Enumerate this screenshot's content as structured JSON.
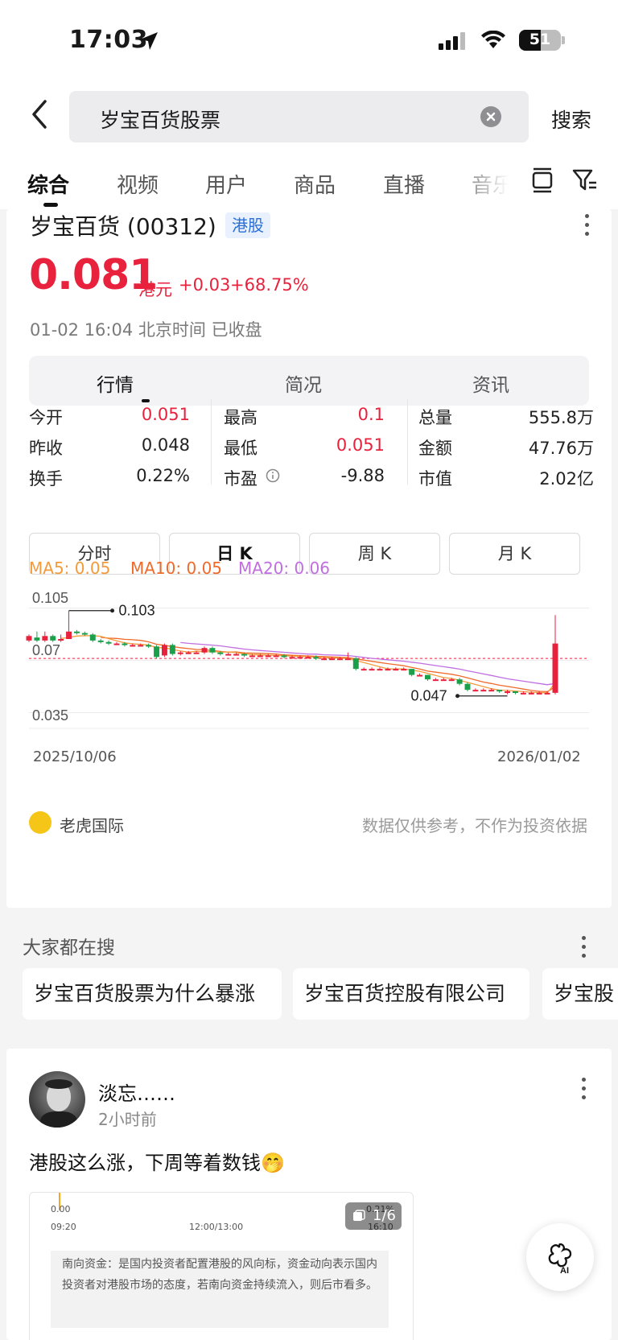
{
  "status_bar": {
    "time": "17:03",
    "battery": "51"
  },
  "search": {
    "query": "岁宝百货股票",
    "button": "搜索"
  },
  "tabs": [
    "综合",
    "视频",
    "用户",
    "商品",
    "直播",
    "音乐"
  ],
  "stock": {
    "name": "岁宝百货 (00312)",
    "market_badge": "港股",
    "price": "0.081",
    "currency": "港元",
    "change": "+0.03",
    "change_pct": "+68.75%",
    "timestamp": "01-02 16:04  北京时间 已收盘",
    "subtabs": [
      "行情",
      "简况",
      "资讯"
    ],
    "quote": [
      {
        "label": "今开",
        "value": "0.051",
        "red": true
      },
      {
        "label": "最高",
        "value": "0.1",
        "red": true
      },
      {
        "label": "总量",
        "value": "555.8万",
        "red": false
      },
      {
        "label": "昨收",
        "value": "0.048",
        "red": false
      },
      {
        "label": "最低",
        "value": "0.051",
        "red": true
      },
      {
        "label": "金额",
        "value": "47.76万",
        "red": false
      },
      {
        "label": "换手",
        "value": "0.22%",
        "red": false
      },
      {
        "label": "市盈",
        "value": "-9.88",
        "red": false
      },
      {
        "label": "市值",
        "value": "2.02亿",
        "red": false
      }
    ],
    "period_buttons": [
      "分时",
      "日 K",
      "周 K",
      "月 K"
    ],
    "ma": {
      "ma5": "MA5: 0.05",
      "ma10": "MA10: 0.05",
      "ma20": "MA20: 0.06"
    },
    "colors": {
      "up": "#e8213d",
      "down": "#1aa04a",
      "ma5": "#f39b3a",
      "ma10": "#f06a2a",
      "ma20": "#c06ee0"
    },
    "source": "老虎国际",
    "disclaimer": "数据仅供参考，不作为投资依据"
  },
  "chart_data": {
    "type": "candlestick",
    "yticks": [
      "0.105",
      "0.07",
      "0.035"
    ],
    "ylim": [
      0.035,
      0.105
    ],
    "x_start": "2025/10/06",
    "x_end": "2026/01/02",
    "high_marker": "0.103",
    "low_marker": "0.047",
    "prev_close_line": 0.071,
    "candles": [
      [
        0.083,
        0.086,
        0.087,
        0.082
      ],
      [
        0.085,
        0.083,
        0.089,
        0.082
      ],
      [
        0.083,
        0.086,
        0.089,
        0.082
      ],
      [
        0.086,
        0.083,
        0.087,
        0.082
      ],
      [
        0.083,
        0.084,
        0.087,
        0.082
      ],
      [
        0.084,
        0.089,
        0.103,
        0.084
      ],
      [
        0.089,
        0.088,
        0.09,
        0.087
      ],
      [
        0.088,
        0.087,
        0.089,
        0.086
      ],
      [
        0.087,
        0.083,
        0.088,
        0.082
      ],
      [
        0.083,
        0.082,
        0.084,
        0.081
      ],
      [
        0.082,
        0.081,
        0.083,
        0.08
      ],
      [
        0.081,
        0.081,
        0.082,
        0.08
      ],
      [
        0.081,
        0.08,
        0.082,
        0.079
      ],
      [
        0.08,
        0.08,
        0.081,
        0.079
      ],
      [
        0.08,
        0.08,
        0.081,
        0.079
      ],
      [
        0.08,
        0.079,
        0.081,
        0.078
      ],
      [
        0.079,
        0.072,
        0.08,
        0.071
      ],
      [
        0.073,
        0.08,
        0.081,
        0.072
      ],
      [
        0.08,
        0.074,
        0.081,
        0.073
      ],
      [
        0.074,
        0.075,
        0.076,
        0.073
      ],
      [
        0.075,
        0.075,
        0.076,
        0.074
      ],
      [
        0.075,
        0.075,
        0.076,
        0.074
      ],
      [
        0.075,
        0.078,
        0.079,
        0.074
      ],
      [
        0.078,
        0.075,
        0.079,
        0.074
      ],
      [
        0.075,
        0.074,
        0.076,
        0.073
      ],
      [
        0.074,
        0.074,
        0.075,
        0.073
      ],
      [
        0.074,
        0.074,
        0.075,
        0.073
      ],
      [
        0.074,
        0.073,
        0.075,
        0.072
      ],
      [
        0.073,
        0.073,
        0.074,
        0.072
      ],
      [
        0.073,
        0.073,
        0.074,
        0.072
      ],
      [
        0.073,
        0.073,
        0.074,
        0.072
      ],
      [
        0.073,
        0.073,
        0.074,
        0.072
      ],
      [
        0.073,
        0.072,
        0.074,
        0.071
      ],
      [
        0.072,
        0.072,
        0.073,
        0.071
      ],
      [
        0.072,
        0.072,
        0.073,
        0.071
      ],
      [
        0.072,
        0.072,
        0.073,
        0.071
      ],
      [
        0.072,
        0.071,
        0.073,
        0.07
      ],
      [
        0.071,
        0.071,
        0.072,
        0.07
      ],
      [
        0.071,
        0.071,
        0.072,
        0.07
      ],
      [
        0.071,
        0.071,
        0.072,
        0.07
      ],
      [
        0.071,
        0.071,
        0.075,
        0.07
      ],
      [
        0.071,
        0.064,
        0.072,
        0.063
      ],
      [
        0.064,
        0.064,
        0.065,
        0.063
      ],
      [
        0.064,
        0.064,
        0.065,
        0.063
      ],
      [
        0.064,
        0.064,
        0.065,
        0.063
      ],
      [
        0.064,
        0.064,
        0.065,
        0.063
      ],
      [
        0.064,
        0.064,
        0.065,
        0.063
      ],
      [
        0.064,
        0.064,
        0.065,
        0.063
      ],
      [
        0.064,
        0.06,
        0.064,
        0.059
      ],
      [
        0.06,
        0.06,
        0.061,
        0.059
      ],
      [
        0.06,
        0.057,
        0.06,
        0.056
      ],
      [
        0.057,
        0.057,
        0.058,
        0.056
      ],
      [
        0.057,
        0.057,
        0.058,
        0.056
      ],
      [
        0.057,
        0.057,
        0.058,
        0.056
      ],
      [
        0.057,
        0.054,
        0.058,
        0.053
      ],
      [
        0.054,
        0.05,
        0.055,
        0.049
      ],
      [
        0.05,
        0.05,
        0.051,
        0.049
      ],
      [
        0.05,
        0.05,
        0.051,
        0.049
      ],
      [
        0.05,
        0.05,
        0.051,
        0.049
      ],
      [
        0.05,
        0.049,
        0.05,
        0.048
      ],
      [
        0.049,
        0.049,
        0.05,
        0.047
      ],
      [
        0.049,
        0.048,
        0.049,
        0.047
      ],
      [
        0.048,
        0.048,
        0.049,
        0.047
      ],
      [
        0.048,
        0.048,
        0.049,
        0.047
      ],
      [
        0.048,
        0.048,
        0.049,
        0.047
      ],
      [
        0.048,
        0.048,
        0.049,
        0.047
      ],
      [
        0.048,
        0.081,
        0.1,
        0.047
      ]
    ]
  },
  "hot_searches": {
    "title": "大家都在搜",
    "items": [
      "岁宝百货股票为什么暴涨",
      "岁宝百货控股有限公司",
      "岁宝股"
    ]
  },
  "post": {
    "username": "淡忘……",
    "time": "2小时前",
    "text": "港股这么涨，下周等着数钱🤭",
    "image_labels": {
      "t0": "0.00",
      "t1": "09:20",
      "t2": "12:00/13:00",
      "t3": "0.21%",
      "t4": "16:10",
      "count": "1/6"
    },
    "image_note": "南向资金：是国内投资者配置港股的风向标，资金动向表示国内投资者对港股市场的态度，若南向资金持续流入，则后市看多。"
  }
}
